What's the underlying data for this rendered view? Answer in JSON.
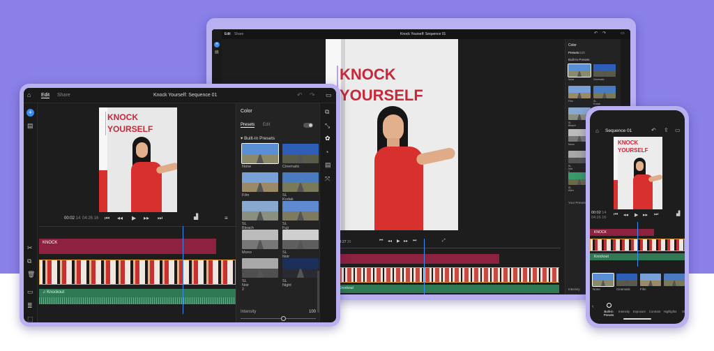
{
  "tablet": {
    "tabs": [
      "Edit",
      "Share"
    ],
    "title": "Knock Yourself: Sequence 01",
    "title_text": [
      "KNOCK",
      "YOURSELF"
    ],
    "timecode_current": "00:02",
    "timecode_frames": "14",
    "timecode_total": "04:26",
    "timecode_total_frames": "16",
    "panel_title": "Color",
    "panel_tabs": [
      "Presets",
      "Edit"
    ],
    "section": "Built-In Presets",
    "presets": [
      "None",
      "Cinematic",
      "Film",
      "SL Kodak",
      "SL Bleach",
      "SL Fuji",
      "Mono",
      "SL Noir 1",
      "SL Noir 2",
      "SL Night"
    ],
    "title_track": "KNOCK",
    "audio_track": "Knockout",
    "intensity_label": "Intensity",
    "intensity_value": "100"
  },
  "laptop": {
    "tabs": [
      "Edit",
      "Share"
    ],
    "title": "Knock Yourself: Sequence 01",
    "title_text": [
      "KNOCK",
      "YOURSELF"
    ],
    "panel_title": "Color",
    "panel_tabs": [
      "Presets",
      "Edit"
    ],
    "section": "Built-In Presets",
    "presets": [
      "None",
      "Cinematic",
      "Film",
      "SL Kodak",
      "SL Bleach",
      "SL Fuji",
      "Mono",
      "SL Noir 1",
      "SL Noir 2",
      "SL Night",
      "SL Alien"
    ],
    "your_presets": "Your Presets",
    "timecode": "04:27",
    "timecode_frames": "20",
    "audio_track": "Knockout",
    "intensity_label": "Intensity"
  },
  "phone": {
    "title": "Sequence 01",
    "title_text": [
      "KNOCK",
      "YOURSELF"
    ],
    "timecode_current": "00:02",
    "timecode_current_frames": "14",
    "timecode_total": "04:26",
    "timecode_total_frames": "16",
    "title_track": "KNOCK",
    "audio_track": "Knockout",
    "presets": [
      "None",
      "Cinematic",
      "Film"
    ],
    "bottom_tabs": [
      "Built-in Presets",
      "Intensity",
      "Exposure",
      "Contrast",
      "Highlights",
      "Shad"
    ]
  },
  "colors": {
    "background": "#8a80e8",
    "accent": "#c8283a",
    "title_clip": "#8c2140",
    "audio_clip": "#2f7a55",
    "playhead": "#3a8cf0"
  }
}
